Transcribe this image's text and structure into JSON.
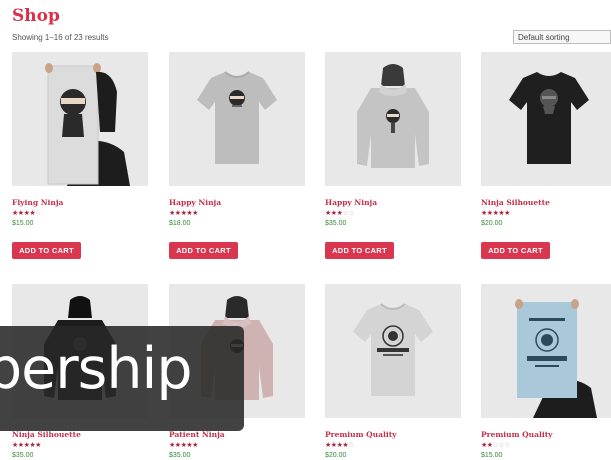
{
  "header": {
    "title": "Shop",
    "result_count": "Showing 1–16 of 23 results",
    "sort_selected": "Default sorting"
  },
  "products": [
    {
      "name": "Flying Ninja",
      "price": "$15.00",
      "rating": 4,
      "button": "ADD TO CART",
      "image": "poster-ninja"
    },
    {
      "name": "Happy Ninja",
      "price": "$18.00",
      "rating": 5,
      "button": "ADD TO CART",
      "image": "tshirt-grey"
    },
    {
      "name": "Happy Ninja",
      "price": "$35.00",
      "rating": 3,
      "button": "ADD TO CART",
      "image": "hoodie-grey"
    },
    {
      "name": "Ninja Silhouette",
      "price": "$20.00",
      "rating": 5,
      "button": "ADD TO CART",
      "image": "tshirt-black"
    },
    {
      "name": "Ninja Silhouette",
      "price": "$35.00",
      "rating": 5,
      "button": "",
      "image": "hoodie-black"
    },
    {
      "name": "Patient Ninja",
      "price": "$35.00",
      "rating": 5,
      "button": "",
      "image": "hoodie-pink"
    },
    {
      "name": "Premium Quality",
      "price": "$20.00",
      "rating": 4,
      "button": "",
      "image": "tshirt-woo"
    },
    {
      "name": "Premium Quality",
      "price": "$15.00",
      "rating": 2,
      "button": "",
      "image": "poster-woo"
    }
  ],
  "overlay": {
    "text": "bership"
  },
  "colors": {
    "accent": "#d9364f",
    "title": "#d9304b",
    "price": "#3a8a3a"
  }
}
